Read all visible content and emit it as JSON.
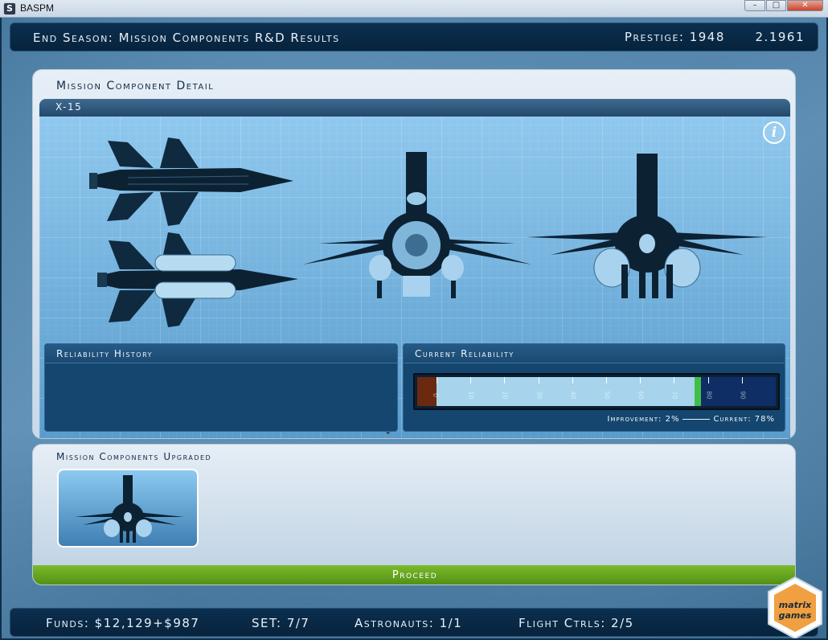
{
  "window": {
    "title": "BASPM",
    "app_icon": "S"
  },
  "header": {
    "screen_title": "End Season: Mission Components R&D Results",
    "prestige": "Prestige: 1948      2.1961"
  },
  "detail": {
    "panel_title": "Mission Component Detail",
    "component_name": "X-15",
    "info_icon": "i",
    "reliability_history_title": "Reliability History",
    "current_reliability_title": "Current Reliability",
    "improvement_label": "Improvement: 2%",
    "current_label": "Current: 78%",
    "reliability": {
      "improvement_pct": 2,
      "current_pct": 78
    },
    "scale_labels": [
      "0",
      "10",
      "20",
      "30",
      "40",
      "50",
      "60",
      "70",
      "80",
      "90",
      "100"
    ]
  },
  "upgraded": {
    "title": "Mission Components Upgraded",
    "items": [
      {
        "name": "X-15"
      }
    ]
  },
  "proceed_label": "Proceed",
  "status": {
    "funds": "Funds: $12,129+$987",
    "set": "SET: 7/7",
    "astronauts": "Astronauts: 1/1",
    "flight_ctrls": "Flight Ctrls: 2/5"
  },
  "logo": {
    "line1": "matrix",
    "line2": "games"
  },
  "colors": {
    "bar_red": "#6b2a10",
    "bar_fill": "#a7d4ec",
    "bar_improvement": "#3fbf48",
    "bar_empty": "#0f2e66",
    "proceed": "#5f9e1e"
  }
}
